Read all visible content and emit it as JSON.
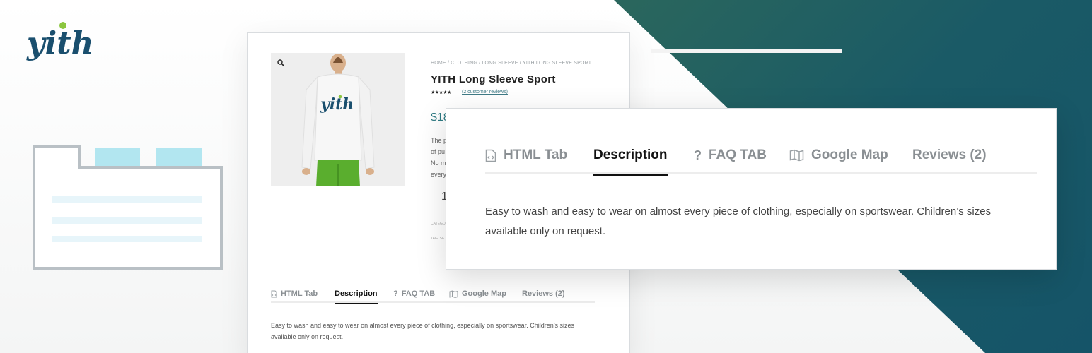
{
  "brand": {
    "logo_text": "yith",
    "colors": {
      "logo_blue": "#1a4f6e",
      "logo_green": "#8cc63f",
      "accent": "#2f7b83"
    }
  },
  "product": {
    "breadcrumb": "HOME / CLOTHING / LONG SLEEVE / YITH LONG SLEEVE SPORT",
    "title": "YITH Long Sleeve Sport",
    "rating_stars": "★★★★★",
    "reviews_link": "(2 customer reviews)",
    "price": "$18",
    "short_description_lines": [
      "The p",
      "of pu",
      "No m",
      "every"
    ],
    "quantity": "1",
    "category_label": "CATEGO",
    "tag_label": "TAG: SE",
    "image_logo_text": "yith"
  },
  "tabs_small": [
    {
      "label": "HTML Tab",
      "icon": "file-code-icon"
    },
    {
      "label": "Description",
      "icon": ""
    },
    {
      "label": "FAQ TAB",
      "icon": "question-icon"
    },
    {
      "label": "Google Map",
      "icon": "map-icon"
    },
    {
      "label": "Reviews (2)",
      "icon": ""
    }
  ],
  "tabs_big": [
    {
      "label": "HTML Tab",
      "icon": "file-code-icon"
    },
    {
      "label": "Description",
      "icon": ""
    },
    {
      "label": "FAQ TAB",
      "icon": "question-icon"
    },
    {
      "label": "Google Map",
      "icon": "map-icon"
    },
    {
      "label": "Reviews (2)",
      "icon": ""
    }
  ],
  "active_tab": "Description",
  "description": {
    "small_line1": "Easy to wash and easy to wear on almost every piece of clothing, especially on sportswear. Children’s sizes",
    "small_line2": "available only on request.",
    "big_line1": "Easy to wash and easy to wear on almost every piece of clothing, especially on sportswear. Children’s sizes",
    "big_line2": "available only on request."
  }
}
